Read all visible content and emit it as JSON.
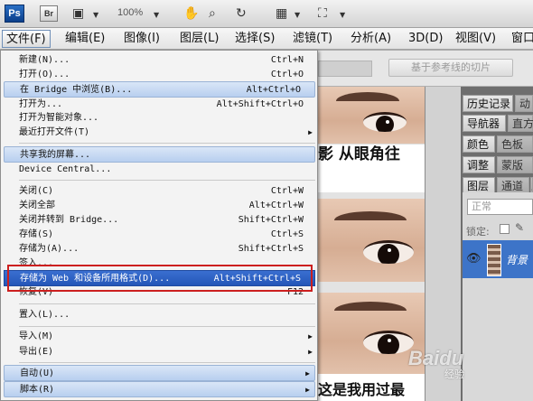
{
  "appbar": {
    "logo": "Ps",
    "bridge": "Br",
    "zoom": "100%"
  },
  "menubar": [
    {
      "label": "文件(F)"
    },
    {
      "label": "编辑(E)"
    },
    {
      "label": "图像(I)"
    },
    {
      "label": "图层(L)"
    },
    {
      "label": "选择(S)"
    },
    {
      "label": "滤镜(T)"
    },
    {
      "label": "分析(A)"
    },
    {
      "label": "3D(D)"
    },
    {
      "label": "视图(V)"
    },
    {
      "label": "窗口"
    }
  ],
  "options": {
    "slice_button": "基于参考线的切片"
  },
  "file_menu": {
    "items": [
      {
        "label": "新建(N)...",
        "shortcut": "Ctrl+N"
      },
      {
        "label": "打开(O)...",
        "shortcut": "Ctrl+O"
      },
      {
        "label": "在 Bridge 中浏览(B)...",
        "shortcut": "Alt+Ctrl+O"
      },
      {
        "label": "打开为...",
        "shortcut": "Alt+Shift+Ctrl+O"
      },
      {
        "label": "打开为智能对象...",
        "shortcut": ""
      },
      {
        "label": "最近打开文件(T)",
        "shortcut": ""
      },
      {
        "label": "共享我的屏幕...",
        "shortcut": ""
      },
      {
        "label": "Device Central...",
        "shortcut": ""
      },
      {
        "label": "关闭(C)",
        "shortcut": "Ctrl+W"
      },
      {
        "label": "关闭全部",
        "shortcut": "Alt+Ctrl+W"
      },
      {
        "label": "关闭并转到 Bridge...",
        "shortcut": "Shift+Ctrl+W"
      },
      {
        "label": "存储(S)",
        "shortcut": "Ctrl+S"
      },
      {
        "label": "存储为(A)...",
        "shortcut": "Shift+Ctrl+S"
      },
      {
        "label": "签入...",
        "shortcut": ""
      },
      {
        "label": "存储为 Web 和设备所用格式(D)...",
        "shortcut": "Alt+Shift+Ctrl+S"
      },
      {
        "label": "恢复(V)",
        "shortcut": "F12"
      },
      {
        "label": "置入(L)...",
        "shortcut": ""
      },
      {
        "label": "导入(M)",
        "shortcut": ""
      },
      {
        "label": "导出(E)",
        "shortcut": ""
      },
      {
        "label": "自动(U)",
        "shortcut": ""
      },
      {
        "label": "脚本(R)",
        "shortcut": ""
      }
    ]
  },
  "canvas": {
    "caption_top": "影 从眼角往",
    "caption_bottom": "这是我用过最"
  },
  "panels": {
    "tabs": [
      "历史记录",
      "动",
      "导航器",
      "直方",
      "颜色",
      "色板",
      "调整",
      "蒙版",
      "图层",
      "通道",
      "路"
    ],
    "blend_mode": "正常",
    "lock_label": "锁定:",
    "layer_name": "背景"
  },
  "watermark": {
    "text": "Baidu",
    "sub": "经验"
  },
  "colors": {
    "selected": "#2456b8",
    "highlight": "#b8cfef",
    "red_box": "#cc1f1f",
    "layer_selected": "#3d74c8"
  }
}
